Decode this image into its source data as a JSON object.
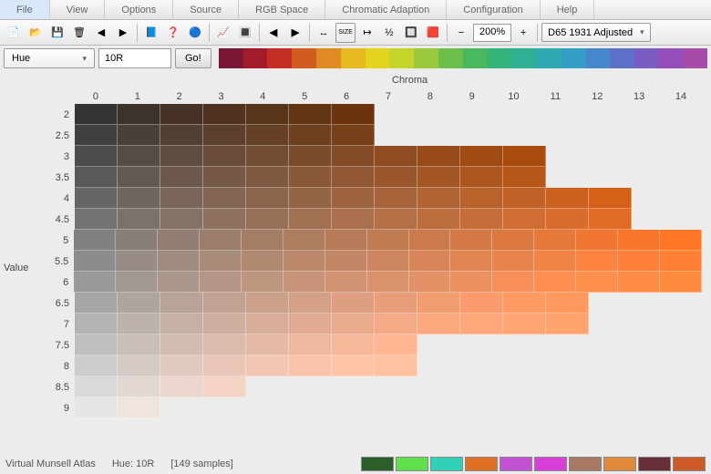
{
  "menu": [
    "File",
    "View",
    "Options",
    "Source",
    "RGB Space",
    "Chromatic Adaption",
    "Configuration",
    "Help"
  ],
  "zoom": "200%",
  "profile": "D65 1931 Adjusted",
  "hue_dropdown": "Hue",
  "hue_input": "10R",
  "go": "Go!",
  "hue_strip": [
    "#7a1734",
    "#a31a2b",
    "#c42c24",
    "#d05d1f",
    "#e18a21",
    "#e6b91e",
    "#e2d41e",
    "#c3d52a",
    "#9ac93d",
    "#6cbf4a",
    "#47ba5e",
    "#33b47a",
    "#2eaf96",
    "#2ea9b1",
    "#359ec5",
    "#4688cc",
    "#5f70c8",
    "#7a5dc2",
    "#9450b8",
    "#a84aa7"
  ],
  "axis_x": "Chroma",
  "axis_y": "Value",
  "cols": [
    "0",
    "1",
    "2",
    "3",
    "4",
    "5",
    "6",
    "7",
    "8",
    "9",
    "10",
    "11",
    "12",
    "13",
    "14"
  ],
  "rows": [
    "2",
    "2.5",
    "3",
    "3.5",
    "4",
    "4.5",
    "5",
    "5.5",
    "6",
    "6.5",
    "7",
    "7.5",
    "8",
    "8.5",
    "9"
  ],
  "row_extent": [
    7,
    7,
    11,
    11,
    13,
    13,
    15,
    15,
    15,
    12,
    12,
    8,
    8,
    4,
    2
  ],
  "status_app": "Virtual Munsell Atlas",
  "status_hue": "Hue: 10R",
  "status_samples": "[149 samples]",
  "status_swatches": [
    "#2b5e2a",
    "#5fe04a",
    "#2fd2b6",
    "#e07022",
    "#c351d4",
    "#d83fd8",
    "#a77864",
    "#e08a3c",
    "#6a2e3b",
    "#ce5b27"
  ],
  "icons": {
    "new": "📄",
    "open": "📂",
    "save": "💾",
    "saveno": "🗑",
    "importL": "◀",
    "importR": "▶",
    "book": "📘",
    "help": "❓",
    "wheel": "🔵",
    "graph": "📈",
    "bars": "🔳",
    "prev": "◀",
    "next": "▶",
    "fit": "↔",
    "size": "SIZE",
    "half": "½",
    "invert": "🔲",
    "toggle": "🟥",
    "minus": "−",
    "plus": "+"
  }
}
